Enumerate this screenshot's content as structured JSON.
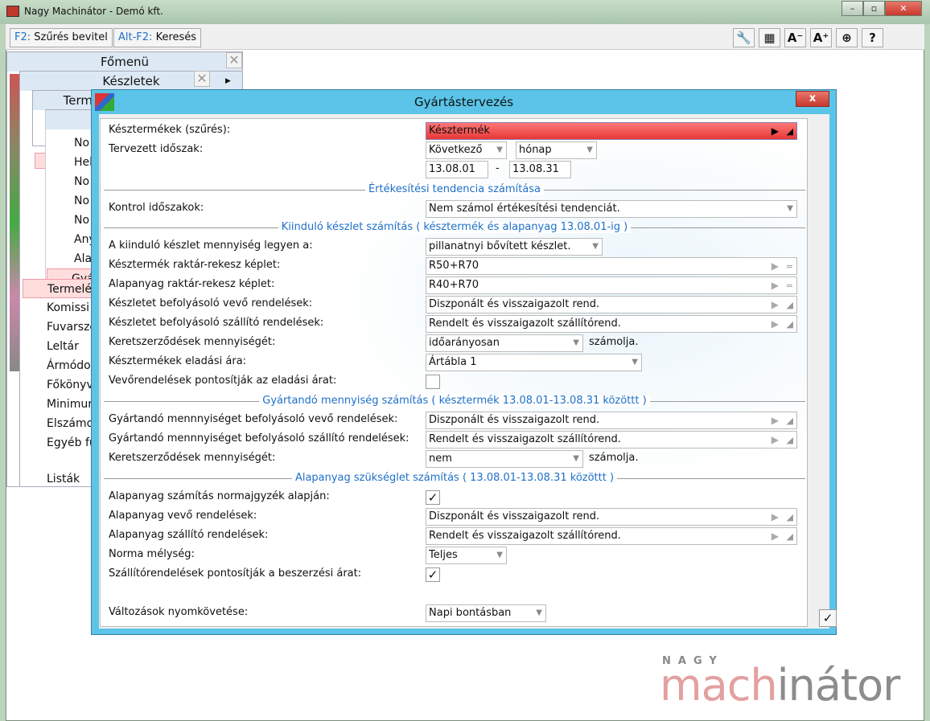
{
  "window": {
    "title": "Nagy Machinátor - Demó kft.",
    "minimize": "–",
    "maximize": "▫",
    "close": "✕"
  },
  "toolbar": {
    "filter_key": "F2:",
    "filter_label": "Szűrés bevitel",
    "search_key": "Alt-F2:",
    "search_label": "Keresés",
    "icons": {
      "settings": "🔧",
      "grid": "▦",
      "font_smaller": "A⁻",
      "font_larger": "A⁺",
      "navigate": "⊕",
      "help": "?"
    }
  },
  "menus": {
    "main_title": "Főmenü",
    "stock_title": "Készletek",
    "third_title": "Term",
    "sub_items": [
      "No",
      "Hel",
      "No",
      "No",
      "No",
      "Any",
      "Ala",
      "Gyá"
    ],
    "main_items": [
      "Termelé",
      "Komissi",
      "Fuvarsze",
      "Leltár",
      "Ármódo",
      "Főkönyv",
      "Minimur",
      "Elszámo",
      "Egyéb fu",
      "Listák"
    ],
    "close": "✕"
  },
  "dialog": {
    "title": "Gyártástervezés",
    "close": "x",
    "ok": "✓",
    "sections": [
      "Értékesítési tendencia számítása",
      "Kiinduló készlet számítás ( késztermék és alapanyag 13.08.01-ig )",
      "Gyártandó mennyiség számítás ( késztermék 13.08.01-13.08.31 közöttt )",
      "Alapanyag szükséglet számítás ( 13.08.01-13.08.31 közöttt )"
    ],
    "fields": {
      "products": {
        "label": "Késztermékek (szűrés):",
        "value": "Késztermék"
      },
      "period": {
        "label": "Tervezett időszak:",
        "relative": "Következő",
        "unit": "hónap",
        "from": "13.08.01",
        "sep": "-",
        "to": "13.08.31"
      },
      "control": {
        "label": "Kontrol időszakok:",
        "value": "Nem számol értékesítési tendenciát."
      },
      "initial": {
        "label": "A kiinduló készlet mennyiség legyen a:",
        "value": "pillanatnyi bővített készlet."
      },
      "prod_bin": {
        "label": "Késztermék raktár-rekesz képlet:",
        "value": "R50+R70"
      },
      "raw_bin": {
        "label": "Alapanyag raktár-rekesz képlet:",
        "value": "R40+R70"
      },
      "stock_cust": {
        "label": "Készletet befolyásoló vevő rendelések:",
        "value": "Diszponált és visszaigazolt rend."
      },
      "stock_supp": {
        "label": "Készletet befolyásoló szállító rendelések:",
        "value": "Rendelt és visszaigazolt szállítórend."
      },
      "frame1": {
        "label": "Keretszerződések mennyiségét:",
        "value": "időarányosan",
        "suffix": "számolja."
      },
      "price": {
        "label": "Késztermékek eladási ára:",
        "value": "Ártábla 1"
      },
      "cust_price": {
        "label": "Vevőrendelések pontosítják az eladási árat:",
        "checked": false
      },
      "prod_cust": {
        "label": "Gyártandó mennnyiséget befolyásoló vevő rendelések:",
        "value": "Diszponált és visszaigazolt rend."
      },
      "prod_supp": {
        "label": "Gyártandó mennnyiséget  befolyásoló szállító rendelések:",
        "value": "Rendelt és visszaigazolt szállítórend."
      },
      "frame2": {
        "label": "Keretszerződések mennyiségét:",
        "value": "nem",
        "suffix": "számolja."
      },
      "bom": {
        "label": "Alapanyag számítás normajgyzék alapján:",
        "checked": true,
        "mark": "✓"
      },
      "raw_cust": {
        "label": "Alapanyag vevő rendelések:",
        "value": "Diszponált és visszaigazolt rend."
      },
      "raw_supp": {
        "label": "Alapanyag szállító rendelések:",
        "value": "Rendelt és visszaigazolt szállítórend."
      },
      "depth": {
        "label": "Norma mélység:",
        "value": "Teljes"
      },
      "supp_price": {
        "label": "Szállítórendelések pontosítják a beszerzési árat:",
        "checked": true,
        "mark": "✓"
      },
      "tracking": {
        "label": "Változások nyomkövetése:",
        "value": "Napi bontásban"
      }
    }
  },
  "logo": {
    "top": "NAGY",
    "part1": "mach",
    "part2": "inátor"
  },
  "colors": {
    "accent": "#1e6fc8",
    "dialog_title": "#5bc4e8",
    "required": "#e63838"
  }
}
